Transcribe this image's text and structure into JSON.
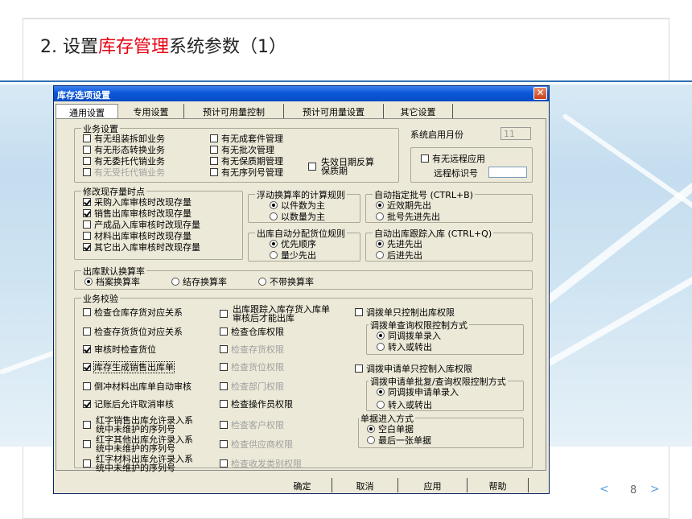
{
  "slide": {
    "title_prefix": "2. 设置",
    "title_highlight": "库存管理",
    "title_suffix": "系统参数（1）",
    "page_number": "8",
    "prev_glyph": "<",
    "next_glyph": ">"
  },
  "window": {
    "title": "库存选项设置",
    "close_glyph": "✕",
    "accent": "#0b56d8"
  },
  "tabs": [
    "通用设置",
    "专用设置",
    "预计可用量控制",
    "预计可用量设置",
    "其它设置"
  ],
  "business_settings": {
    "legend": "业务设置",
    "col1": [
      {
        "label": "有无组装拆卸业务",
        "checked": false,
        "disabled": false
      },
      {
        "label": "有无形态转换业务",
        "checked": false,
        "disabled": false
      },
      {
        "label": "有无委托代销业务",
        "checked": false,
        "disabled": false
      },
      {
        "label": "有无受托代销业务",
        "checked": false,
        "disabled": true
      }
    ],
    "col2": [
      {
        "label": "有无成套件管理",
        "checked": false
      },
      {
        "label": "有无批次管理",
        "checked": false
      },
      {
        "label": "有无保质期管理",
        "checked": false
      },
      {
        "label": "有无序列号管理",
        "checked": false
      }
    ],
    "expiry_reverse_label_1": "失效日期反算",
    "expiry_reverse_label_2": "保质期"
  },
  "system_month": {
    "label": "系统启用月份",
    "value": "11"
  },
  "remote": {
    "checkbox_label": "有无远程应用",
    "id_label": "远程标识号",
    "id_value": ""
  },
  "stock_update": {
    "legend": "修改现存量时点",
    "items": [
      {
        "label": "采购入库审核时改现存量",
        "checked": true
      },
      {
        "label": "销售出库审核时改现存量",
        "checked": true
      },
      {
        "label": "产成品入库审核时改现存量",
        "checked": false
      },
      {
        "label": "材料出库审核时改现存量",
        "checked": false
      },
      {
        "label": "其它出入库审核时改现存量",
        "checked": true
      }
    ]
  },
  "float_rate": {
    "legend": "浮动换算率的计算规则",
    "options": [
      {
        "label": "以件数为主",
        "selected": true
      },
      {
        "label": "以数量为主",
        "selected": false
      }
    ]
  },
  "auto_batch": {
    "legend": "自动指定批号 (CTRL+B)",
    "options": [
      {
        "label": "近效期先出",
        "selected": true
      },
      {
        "label": "批号先进先出",
        "selected": false
      }
    ]
  },
  "auto_alloc": {
    "legend": "出库自动分配货位规则",
    "options": [
      {
        "label": "优先顺序",
        "selected": true
      },
      {
        "label": "量少先出",
        "selected": false
      }
    ]
  },
  "auto_trace": {
    "legend": "自动出库跟踪入库 (CTRL+Q)",
    "options": [
      {
        "label": "先进先出",
        "selected": true
      },
      {
        "label": "后进先出",
        "selected": false
      }
    ]
  },
  "default_rate": {
    "legend": "出库默认换算率",
    "options": [
      {
        "label": "档案换算率",
        "selected": true
      },
      {
        "label": "结存换算率",
        "selected": false
      },
      {
        "label": "不带换算率",
        "selected": false
      }
    ]
  },
  "validation": {
    "legend": "业务校验",
    "col1": [
      {
        "label": "检查仓库存货对应关系",
        "checked": false
      },
      {
        "label": "检查存货货位对应关系",
        "checked": false
      },
      {
        "label": "审核时检查货位",
        "checked": true
      },
      {
        "label": "库存生成销售出库单",
        "checked": true,
        "focused": true
      },
      {
        "label": "倒冲材料出库单自动审核",
        "checked": false
      },
      {
        "label": "记账后允许取消审核",
        "checked": true
      },
      {
        "label1": "红字销售出库允许录入系",
        "label2": "统中未维护的序列号",
        "checked": false
      },
      {
        "label1": "红字其他出库允许录入系",
        "label2": "统中未维护的序列号",
        "checked": false
      },
      {
        "label1": "红字材料出库允许录入系",
        "label2": "统中未维护的序列号",
        "checked": false
      }
    ],
    "col2_first_line1": "出库跟踪入库存货入库单",
    "col2_first_line2": "审核后才能出库",
    "col2": [
      {
        "label": "检查仓库权限",
        "checked": false,
        "disabled": false
      },
      {
        "label": "检查存货权限",
        "checked": false,
        "disabled": true
      },
      {
        "label": "检查货位权限",
        "checked": false,
        "disabled": true
      },
      {
        "label": "检查部门权限",
        "checked": false,
        "disabled": true
      },
      {
        "label": "检查操作员权限",
        "checked": false,
        "disabled": false
      },
      {
        "label": "检查客户权限",
        "checked": false,
        "disabled": true
      },
      {
        "label": "检查供应商权限",
        "checked": false,
        "disabled": true
      },
      {
        "label": "检查收发类别权限",
        "checked": false,
        "disabled": true
      }
    ]
  },
  "transfer": {
    "out_only": "调拨单只控制出库权限",
    "query_legend": "调拨单查询权限控制方式",
    "query_options": [
      {
        "label": "同调拨单录入",
        "selected": true
      },
      {
        "label": "转入或转出",
        "selected": false
      }
    ],
    "in_only": "调拨申请单只控制入库权限",
    "approve_legend": "调拨申请单批复/查询权限控制方式",
    "approve_options": [
      {
        "label": "同调拨申请单录入",
        "selected": true
      },
      {
        "label": "转入或转出",
        "selected": false
      }
    ]
  },
  "doc_entry": {
    "legend": "单据进入方式",
    "options": [
      {
        "label": "空白单据",
        "selected": true
      },
      {
        "label": "最后一张单据",
        "selected": false
      }
    ]
  },
  "buttons": [
    "确定",
    "取消",
    "应用",
    "帮助"
  ]
}
